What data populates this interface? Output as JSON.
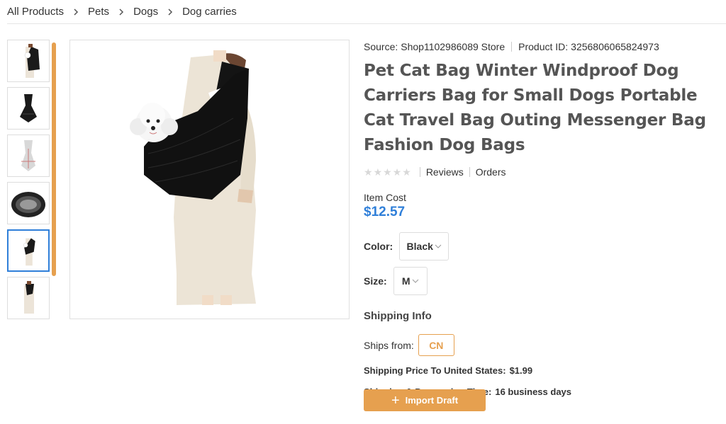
{
  "breadcrumb": [
    "All Products",
    "Pets",
    "Dogs",
    "Dog carries"
  ],
  "product": {
    "source_label": "Source:",
    "source_value": "Shop1102986089 Store",
    "id_label": "Product ID:",
    "id_value": "3256806065824973",
    "title": "Pet Cat Bag Winter Windproof Dog Carriers Bag for Small Dogs Portable Cat Travel Bag Outing Messenger Bag Fashion Dog Bags",
    "rating_stars": 0,
    "reviews_label": "Reviews",
    "orders_label": "Orders",
    "cost_label": "Item Cost",
    "price": "$12.57"
  },
  "options": {
    "color_label": "Color:",
    "color_value": "Black",
    "size_label": "Size:",
    "size_value": "M"
  },
  "shipping": {
    "title": "Shipping Info",
    "ships_from_label": "Ships from:",
    "ships_from_value": "CN",
    "price_label": "Shipping Price To United States:",
    "price_value": "$1.99",
    "time_label": "Shipping & Processing Time:",
    "time_value": "16 business days"
  },
  "actions": {
    "import_label": "Import Draft"
  },
  "colors": {
    "accent": "#e6a04f",
    "price": "#2f7fd9",
    "active_thumb_border": "#2f7fd9"
  }
}
